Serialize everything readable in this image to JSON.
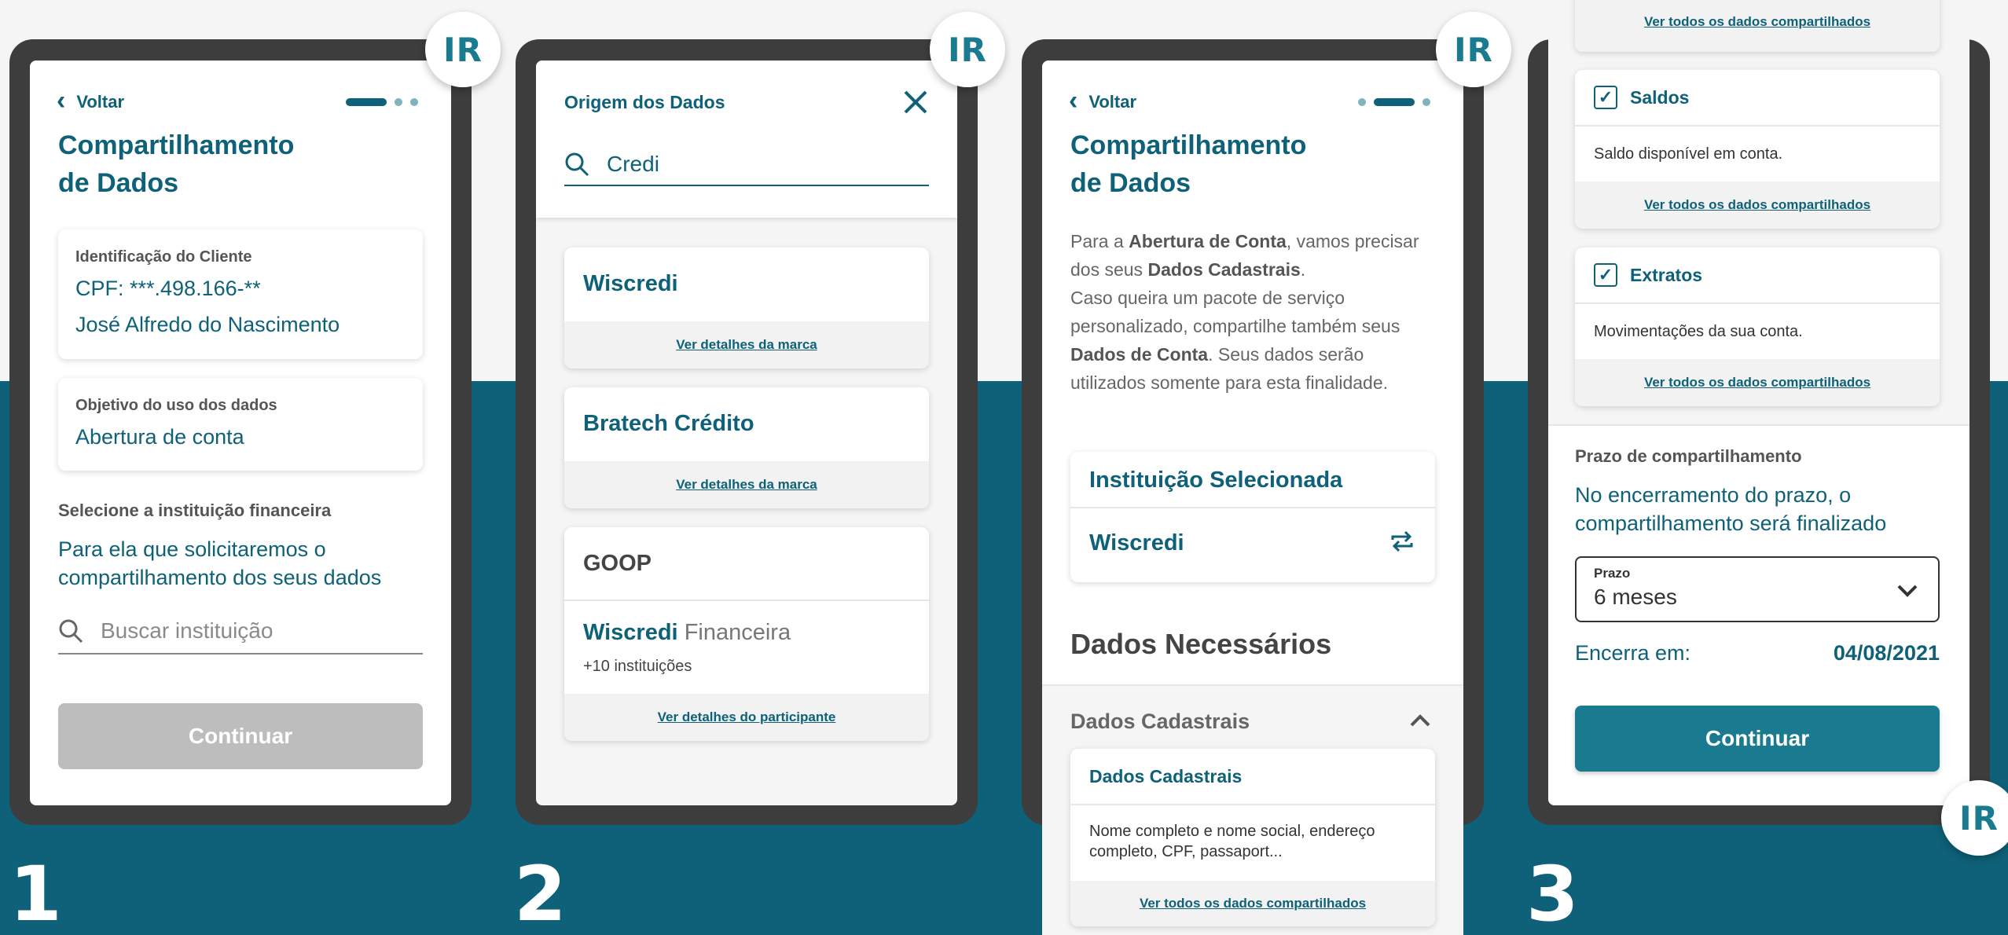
{
  "badge": "IR",
  "steps": [
    "1",
    "2",
    "3"
  ],
  "s1": {
    "back": "Voltar",
    "title_l1": "Compartilhamento",
    "title_l2": "de Dados",
    "client_label": "Identificação do Cliente",
    "cpf": "CPF: ***.498.166-**",
    "name": "José Alfredo do Nascimento",
    "purpose_label": "Objetivo do uso dos dados",
    "purpose_val": "Abertura de conta",
    "select_label": "Selecione a instituição financeira",
    "select_text": "Para ela que solicitaremos o compartilhamento dos seus dados",
    "search_placeholder": "Buscar instituição",
    "continue": "Continuar"
  },
  "s2": {
    "header_title": "Origem dos Dados",
    "search_value": "Credi",
    "cards": [
      {
        "title": "Wiscredi",
        "link": "Ver detalhes da marca"
      },
      {
        "title": "Bratech Crédito",
        "link": "Ver detalhes da marca"
      }
    ],
    "goop": {
      "title": "GOOP",
      "brand_bold": "Wiscredi",
      "brand_rest": "Financeira",
      "count": "+10 instituições",
      "link": "Ver detalhes do participante"
    }
  },
  "s3": {
    "back": "Voltar",
    "title_l1": "Compartilhamento",
    "title_l2": "de Dados",
    "p_1": "Para a ",
    "p_b1": "Abertura de Conta",
    "p_2": ", vamos precisar dos seus ",
    "p_b2": "Dados Cadastrais",
    "p_3": ".",
    "p_4": "Caso queira um pacote de serviço personalizado, compartilhe também seus ",
    "p_b3": "Dados de Conta",
    "p_5": ". Seus dados serão utilizados somente para esta finalidade.",
    "inst_header": "Instituição Selecionada",
    "inst_name": "Wiscredi",
    "needed_title": "Dados Necessários",
    "accordion_label": "Dados Cadastrais",
    "card_title": "Dados Cadastrais",
    "card_desc": "Nome completo e nome social, endereço completo, CPF, passaport...",
    "card_link": "Ver todos os dados compartilhados"
  },
  "s4": {
    "top_link": "Ver todos os dados compartilhados",
    "items": [
      {
        "title": "Saldos",
        "desc": "Saldo disponível em conta.",
        "link": "Ver todos os dados compartilhados"
      },
      {
        "title": "Extratos",
        "desc": "Movimentações da sua conta.",
        "link": "Ver todos os dados compartilhados"
      }
    ],
    "term_label": "Prazo de compartilhamento",
    "term_text": "No encerramento do prazo, o compartilhamento será finalizado",
    "select_label": "Prazo",
    "select_value": "6 meses",
    "ends_label": "Encerra em:",
    "ends_date": "04/08/2021",
    "continue": "Continuar"
  },
  "colors": {
    "teal": "#0e6178",
    "accent": "#1a7a8f",
    "disabled": "#bdbdbd",
    "frame": "#3d3d3d"
  }
}
